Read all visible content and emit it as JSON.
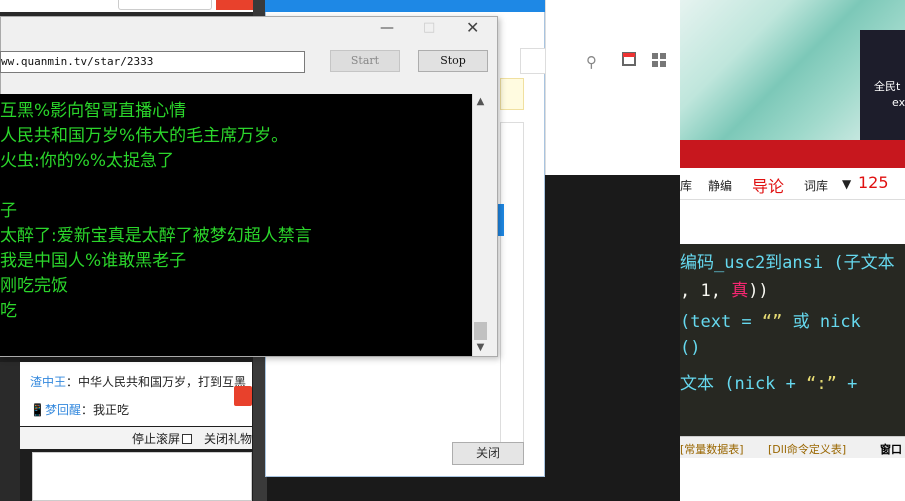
{
  "chat": {
    "messages": [
      {
        "name": "渣中王",
        "text": "：中华人民共和国万岁，打到互黑"
      },
      {
        "name": "梦回醒",
        "text": "：我正吃"
      }
    ],
    "stop_scroll": "停止滚屏",
    "close_gifts": "关闭礼物"
  },
  "dialog": {
    "close_label": "关闭"
  },
  "console_window": {
    "url": "ww.quanmin.tv/star/2333",
    "start_label": "Start",
    "stop_label": "Stop",
    "lines": [
      "互黑%影向智哥直播心情",
      "人民共和国万岁%伟大的毛主席万岁。",
      "火虫:你的%%太捉急了",
      "",
      "子",
      "太醉了:爱新宝真是太醉了被梦幻超人禁言",
      "我是中国人%谁敢黑老子",
      "刚吃完饭",
      "吃"
    ]
  },
  "right_image": {
    "text1": "全民t",
    "text2": "ex"
  },
  "editor_toolbar": {
    "items": [
      "库",
      "静编",
      "导论",
      "词库",
      "125"
    ]
  },
  "editor": {
    "lines": [
      {
        "segments": [
          {
            "t": " 编码_usc2到ansi (子文本",
            "c": "#66d9ef"
          }
        ]
      },
      {
        "segments": [
          {
            "t": ", 1, ",
            "c": "#f8f8f2"
          },
          {
            "t": "真",
            "c": "#f92672"
          },
          {
            "t": "))",
            "c": "#f8f8f2"
          }
        ]
      },
      {
        "segments": [
          {
            "t": "(text = ",
            "c": "#66d9ef"
          },
          {
            "t": "“”",
            "c": "#e6db74"
          },
          {
            "t": " 或 nick",
            "c": "#66d9ef"
          }
        ]
      },
      {
        "segments": [
          {
            "t": "()",
            "c": "#66d9ef"
          }
        ]
      },
      {
        "segments": [
          {
            "t": "文本 (nick + ",
            "c": "#66d9ef"
          },
          {
            "t": "“:”",
            "c": "#e6db74"
          },
          {
            "t": " + ",
            "c": "#66d9ef"
          }
        ]
      }
    ]
  },
  "editor_tabs": [
    "[常量数据表]",
    "[Dll命令定义表]",
    "窗口"
  ],
  "colors": {
    "console_text": "#2bd62b",
    "accent_blue": "#1e88e5",
    "red_banner": "#c7171e"
  }
}
